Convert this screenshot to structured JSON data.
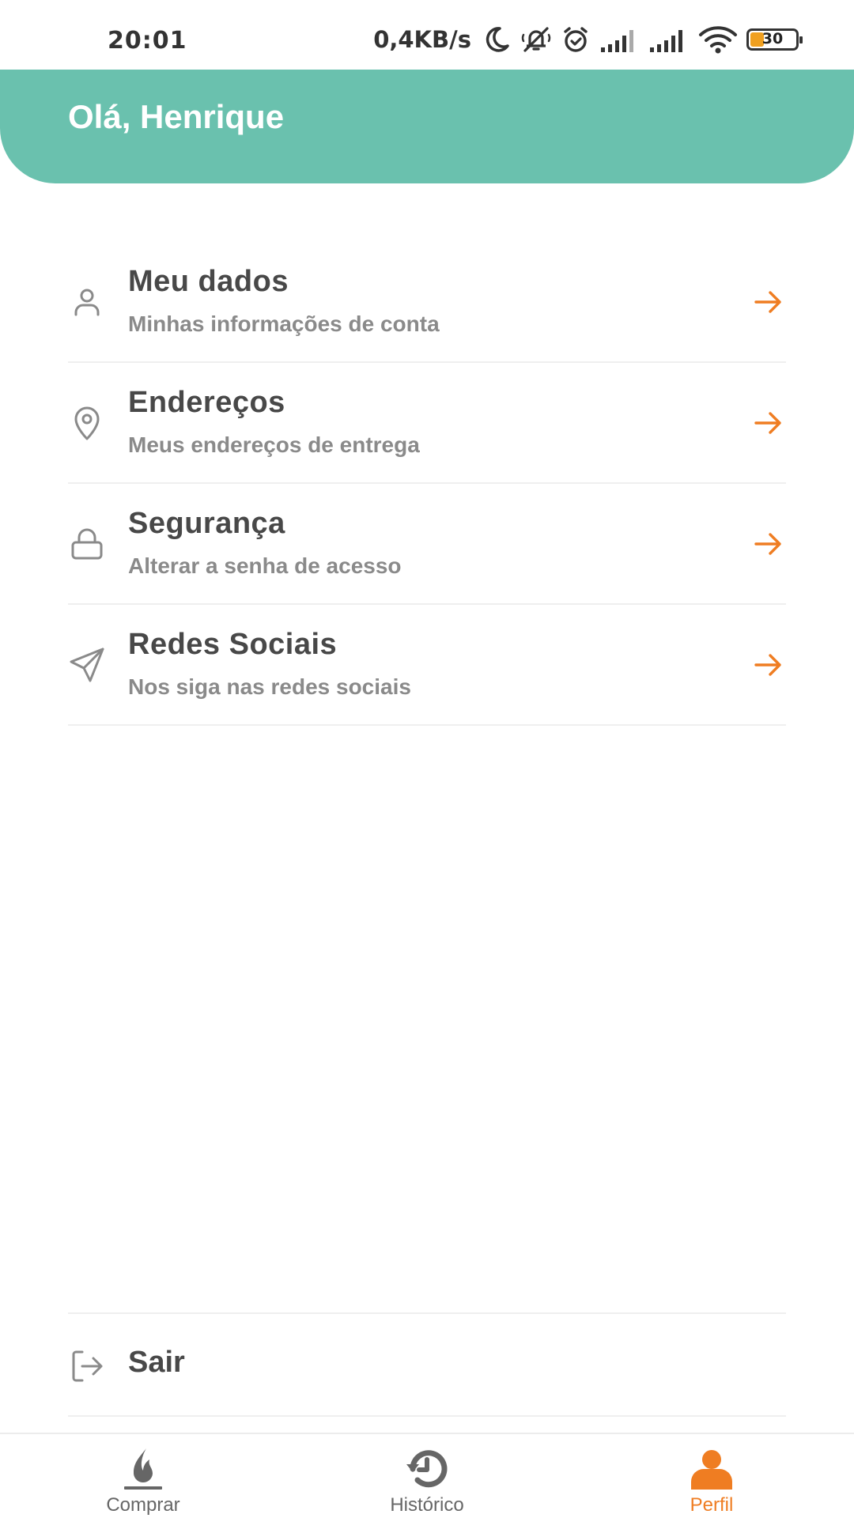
{
  "status_bar": {
    "time": "20:01",
    "net_speed": "0,4KB/s",
    "battery_level": "30",
    "battery_percent": 30,
    "icons": [
      "moon-icon",
      "mute-icon",
      "alarm-icon",
      "signal-icon",
      "signal-icon",
      "wifi-icon",
      "battery-icon"
    ]
  },
  "header": {
    "greeting": "Olá, Henrique",
    "color": "#6ac1ae"
  },
  "menu": {
    "items": [
      {
        "title": "Meu dados",
        "subtitle": "Minhas informações de conta",
        "icon": "user-icon"
      },
      {
        "title": "Endereços",
        "subtitle": "Meus endereços de entrega",
        "icon": "location-pin-icon"
      },
      {
        "title": "Segurança",
        "subtitle": "Alterar a senha de acesso",
        "icon": "lock-icon"
      },
      {
        "title": "Redes Sociais",
        "subtitle": "Nos siga nas redes sociais",
        "icon": "send-icon"
      }
    ],
    "arrow_icon": "arrow-right-icon",
    "accent": "#ef7d22"
  },
  "logout": {
    "label": "Sair",
    "icon": "logout-icon"
  },
  "bottom_nav": {
    "items": [
      {
        "label": "Comprar",
        "icon": "flame-icon",
        "active": false
      },
      {
        "label": "Histórico",
        "icon": "history-icon",
        "active": false
      },
      {
        "label": "Perfil",
        "icon": "profile-icon",
        "active": true
      }
    ],
    "active_color": "#ef7d22",
    "inactive_color": "#666666"
  }
}
